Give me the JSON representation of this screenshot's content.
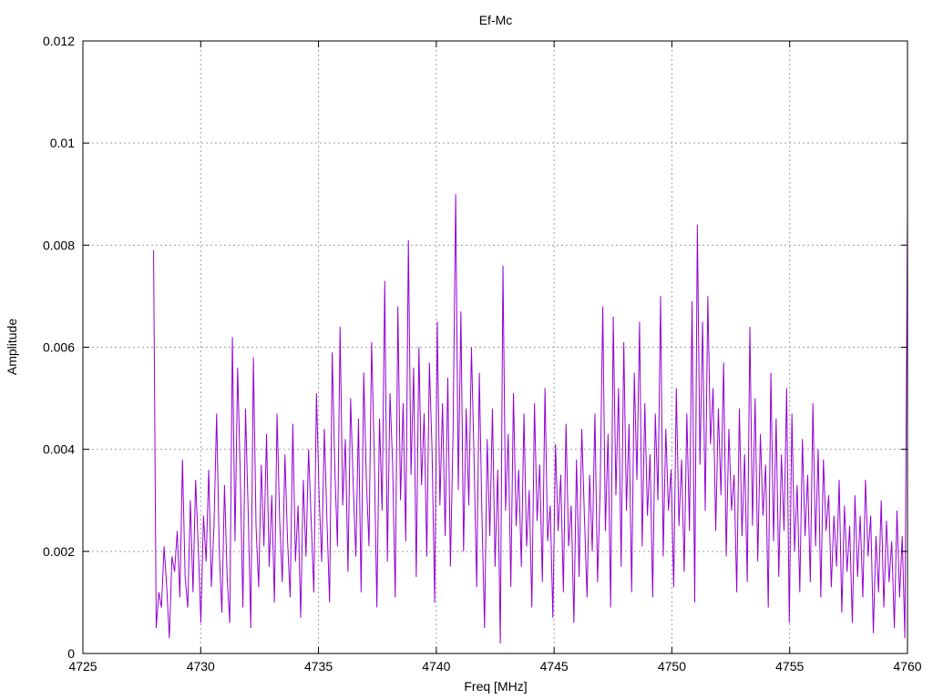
{
  "chart_data": {
    "type": "line",
    "title": "Ef-Mc",
    "xlabel": "Freq [MHz]",
    "ylabel": "Amplitude",
    "xlim": [
      4725,
      4760
    ],
    "ylim": [
      0,
      0.012
    ],
    "x_ticks": [
      "4725",
      "4730",
      "4735",
      "4740",
      "4745",
      "4750",
      "4755",
      "4760"
    ],
    "y_ticks": [
      "0",
      "0.002",
      "0.004",
      "0.006",
      "0.008",
      "0.01",
      "0.012"
    ],
    "grid": true,
    "series_color": "#9400d3",
    "series": [
      {
        "x_start": 4728,
        "x_end": 4760,
        "values": [
          0.0079,
          0.0005,
          0.0012,
          0.0009,
          0.0021,
          0.0013,
          0.0003,
          0.0019,
          0.0016,
          0.0024,
          0.0011,
          0.0038,
          0.0015,
          0.0009,
          0.003,
          0.0012,
          0.0034,
          0.0021,
          0.0006,
          0.0027,
          0.0018,
          0.0036,
          0.0013,
          0.0025,
          0.0047,
          0.002,
          0.0008,
          0.0033,
          0.0015,
          0.0006,
          0.0062,
          0.0022,
          0.0056,
          0.0035,
          0.0009,
          0.0048,
          0.0028,
          0.0005,
          0.0058,
          0.0025,
          0.0013,
          0.0037,
          0.0021,
          0.0043,
          0.0017,
          0.0031,
          0.001,
          0.0047,
          0.0026,
          0.0014,
          0.0039,
          0.0022,
          0.0011,
          0.0045,
          0.0018,
          0.0029,
          0.0007,
          0.0034,
          0.0019,
          0.004,
          0.0026,
          0.0012,
          0.0051,
          0.0031,
          0.0018,
          0.0044,
          0.0026,
          0.001,
          0.0059,
          0.0036,
          0.0021,
          0.0064,
          0.0029,
          0.0042,
          0.0016,
          0.005,
          0.0033,
          0.0019,
          0.0046,
          0.0012,
          0.0055,
          0.0034,
          0.0021,
          0.0061,
          0.0039,
          0.0009,
          0.0046,
          0.0028,
          0.0073,
          0.0018,
          0.0051,
          0.0037,
          0.0011,
          0.0068,
          0.003,
          0.0049,
          0.0022,
          0.0081,
          0.0035,
          0.0056,
          0.0015,
          0.006,
          0.0033,
          0.0047,
          0.0019,
          0.0057,
          0.004,
          0.001,
          0.0065,
          0.0029,
          0.0049,
          0.0023,
          0.0054,
          0.0017,
          0.0043,
          0.009,
          0.0032,
          0.0067,
          0.002,
          0.0048,
          0.0029,
          0.006,
          0.0038,
          0.0013,
          0.0055,
          0.0027,
          0.0005,
          0.0042,
          0.0023,
          0.0048,
          0.0017,
          0.0036,
          0.0002,
          0.0076,
          0.0028,
          0.0043,
          0.0013,
          0.0051,
          0.0025,
          0.0036,
          0.0017,
          0.0047,
          0.0021,
          0.0032,
          0.0009,
          0.0049,
          0.0026,
          0.0037,
          0.0014,
          0.0052,
          0.0022,
          0.0029,
          0.0007,
          0.0041,
          0.0024,
          0.0035,
          0.0012,
          0.0045,
          0.0021,
          0.0029,
          0.0006,
          0.0038,
          0.0015,
          0.0044,
          0.0027,
          0.0011,
          0.0035,
          0.002,
          0.0047,
          0.0014,
          0.0032,
          0.0068,
          0.0024,
          0.0043,
          0.0009,
          0.0066,
          0.0031,
          0.0052,
          0.0017,
          0.0061,
          0.0028,
          0.0045,
          0.0012,
          0.0055,
          0.0034,
          0.0065,
          0.0021,
          0.0049,
          0.0027,
          0.0039,
          0.0011,
          0.0047,
          0.003,
          0.007,
          0.0019,
          0.0044,
          0.0028,
          0.0036,
          0.0013,
          0.0052,
          0.0025,
          0.0038,
          0.0016,
          0.0047,
          0.0024,
          0.0069,
          0.001,
          0.0084,
          0.0037,
          0.0065,
          0.0028,
          0.007,
          0.0041,
          0.0052,
          0.0024,
          0.0048,
          0.0031,
          0.0057,
          0.0019,
          0.0044,
          0.0028,
          0.0035,
          0.0012,
          0.0048,
          0.0023,
          0.0039,
          0.0014,
          0.0064,
          0.0025,
          0.005,
          0.0018,
          0.0043,
          0.0027,
          0.0037,
          0.0009,
          0.0055,
          0.0022,
          0.0046,
          0.0015,
          0.0039,
          0.0024,
          0.0052,
          0.0006,
          0.0047,
          0.002,
          0.0033,
          0.0012,
          0.0042,
          0.0023,
          0.0035,
          0.0014,
          0.0049,
          0.0021,
          0.004,
          0.0011,
          0.0038,
          0.0024,
          0.0031,
          0.0013,
          0.0027,
          0.0017,
          0.0034,
          0.0008,
          0.0029,
          0.0016,
          0.0025,
          0.0006,
          0.0031,
          0.0015,
          0.0027,
          0.0011,
          0.0034,
          0.0019,
          0.0027,
          0.0004,
          0.0023,
          0.0012,
          0.003,
          0.0009,
          0.0026,
          0.0014,
          0.0022,
          0.0005,
          0.0028,
          0.0011,
          0.0023,
          0.0003,
          0.0087
        ]
      }
    ]
  }
}
